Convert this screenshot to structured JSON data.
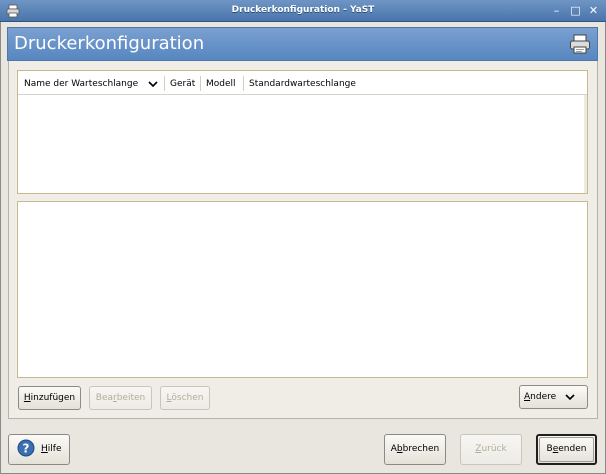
{
  "window": {
    "title": "Druckerkonfiguration - YaST",
    "icon": "printer-icon",
    "controls": [
      "minimize-icon",
      "maximize-icon",
      "close-icon"
    ],
    "control_glyphs": {
      "minimize": "–",
      "maximize": "□",
      "close": "✕"
    }
  },
  "header": {
    "title": "Druckerkonfiguration",
    "icon": "printer-icon"
  },
  "table": {
    "columns": [
      {
        "label": "Name der Warteschlange",
        "sorted": "descending"
      },
      {
        "label": "Gerät"
      },
      {
        "label": "Modell"
      },
      {
        "label": "Standardwarteschlange"
      }
    ],
    "rows": []
  },
  "actions": {
    "add": {
      "pre": "",
      "mn": "H",
      "post": "inzufügen",
      "enabled": true
    },
    "edit": {
      "pre": "Bea",
      "mn": "r",
      "post": "beiten",
      "enabled": false
    },
    "delete": {
      "pre": "",
      "mn": "L",
      "post": "öschen",
      "enabled": false
    },
    "other": {
      "pre": "",
      "mn": "A",
      "post": "ndere",
      "enabled": true
    }
  },
  "footer": {
    "help": {
      "pre": "",
      "mn": "H",
      "post": "ilfe",
      "icon": "help-icon"
    },
    "cancel": {
      "pre": "A",
      "mn": "b",
      "post": "brechen",
      "enabled": true
    },
    "back": {
      "pre": "",
      "mn": "Z",
      "post": "urück",
      "enabled": false
    },
    "finish": {
      "pre": "B",
      "mn": "e",
      "post": "enden",
      "enabled": true,
      "default": true
    }
  },
  "colors": {
    "titlebar": "#5a82b6",
    "header": "#6a93c9",
    "frame_border": "#c9b98f",
    "disabled_text": "#b3ad9c"
  }
}
